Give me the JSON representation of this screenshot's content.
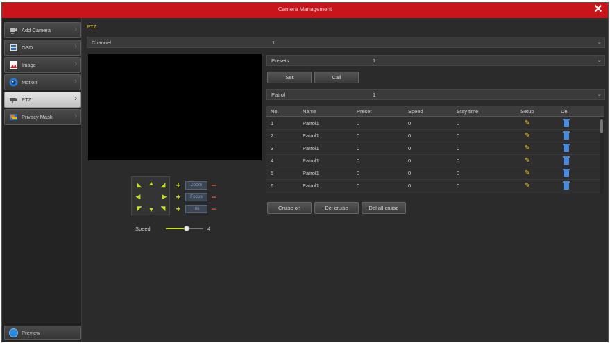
{
  "window": {
    "title": "Camera Management",
    "close_glyph": "✕"
  },
  "sidebar": {
    "items": [
      {
        "label": "Add Camera",
        "icon": "camera-add-icon"
      },
      {
        "label": "OSD",
        "icon": "osd-icon"
      },
      {
        "label": "Image",
        "icon": "image-icon"
      },
      {
        "label": "Motion",
        "icon": "motion-icon"
      },
      {
        "label": "PTZ",
        "icon": "ptz-icon",
        "active": true
      },
      {
        "label": "Privacy Mask",
        "icon": "privacy-mask-icon"
      }
    ],
    "preview_label": "Preview"
  },
  "main": {
    "section_title": "PTZ",
    "channel": {
      "label": "Channel",
      "value": "1"
    },
    "presets": {
      "label": "Presets",
      "value": "1"
    },
    "set_label": "Set",
    "call_label": "Call",
    "patrol": {
      "label": "Patrol",
      "value": "1"
    }
  },
  "ptz": {
    "zoom_label": "Zoom",
    "focus_label": "Focus",
    "iris_label": "Iris",
    "speed_label": "Speed",
    "speed_value": "4",
    "speed_fraction": 0.55
  },
  "table": {
    "headers": [
      "No.",
      "Name",
      "Preset",
      "Speed",
      "Stay time",
      "Setup",
      "Del"
    ],
    "rows": [
      [
        "1",
        "Patrol1",
        "0",
        "0",
        "0"
      ],
      [
        "2",
        "Patrol1",
        "0",
        "0",
        "0"
      ],
      [
        "3",
        "Patrol1",
        "0",
        "0",
        "0"
      ],
      [
        "4",
        "Patrol1",
        "0",
        "0",
        "0"
      ],
      [
        "5",
        "Patrol1",
        "0",
        "0",
        "0"
      ],
      [
        "6",
        "Patrol1",
        "0",
        "0",
        "0"
      ]
    ]
  },
  "cruise": {
    "cruise_on_label": "Cruise on",
    "del_cruise_label": "Del cruise",
    "del_all_cruise_label": "Del all cruise"
  },
  "colors": {
    "titlebar": "#c8151b",
    "accent_yellow": "#e3c21f",
    "arrow_green": "#c6e020",
    "minus_orange": "#e05020"
  }
}
